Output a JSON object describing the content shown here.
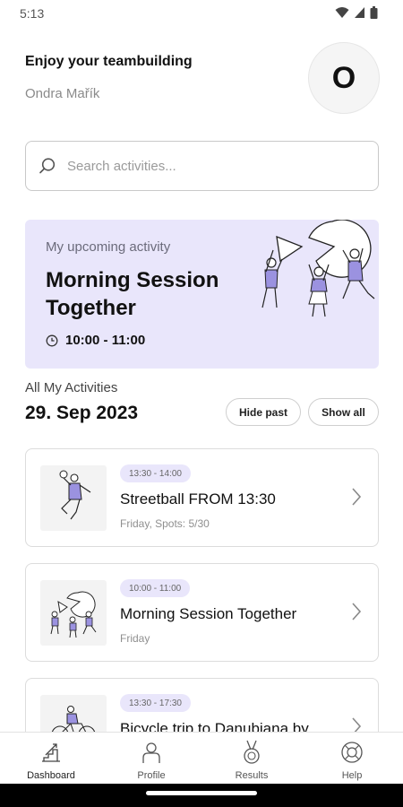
{
  "status_bar": {
    "time": "5:13"
  },
  "header": {
    "greeting": "Enjoy your teambuilding",
    "user_name": "Ondra Mařík",
    "avatar_initial": "O"
  },
  "search": {
    "placeholder": "Search activities..."
  },
  "upcoming": {
    "label": "My upcoming activity",
    "title": "Morning Session Together",
    "time": "10:00 - 11:00"
  },
  "activities_section": {
    "label": "All My Activities",
    "date": "29. Sep 2023",
    "hide_past_label": "Hide past",
    "show_all_label": "Show all"
  },
  "activities": [
    {
      "time": "13:30 - 14:00",
      "title": "Streetball FROM 13:30",
      "subtitle": "Friday, Spots: 5/30"
    },
    {
      "time": "10:00 - 11:00",
      "title": "Morning Session Together",
      "subtitle": "Friday"
    },
    {
      "time": "13:30 - 17:30",
      "title": "Bicycle trip to Danubiana by",
      "subtitle": ""
    }
  ],
  "bottom_nav": [
    {
      "label": "Dashboard",
      "icon": "dashboard-icon"
    },
    {
      "label": "Profile",
      "icon": "profile-icon"
    },
    {
      "label": "Results",
      "icon": "medal-icon"
    },
    {
      "label": "Help",
      "icon": "help-icon"
    }
  ],
  "colors": {
    "accent_light": "#e9e6fb",
    "accent": "#9b92e0"
  }
}
